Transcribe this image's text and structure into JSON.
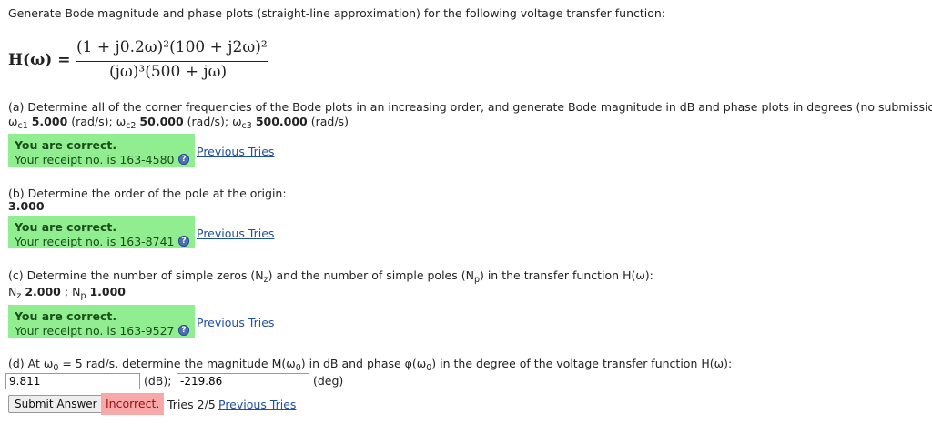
{
  "intro": "Generate Bode magnitude and phase plots (straight-line approximation) for the following voltage transfer function:",
  "formula": {
    "lhs": "H(ω) =",
    "numerator": "(1 + j0.2ω)²(100 + j2ω)²",
    "denominator": "(jω)³(500 + jω)"
  },
  "part_a": {
    "question": "(a) Determine all of the corner frequencies of the Bode plots in an increasing order, and generate Bode magnitude in dB and phase plots in degrees (no submission).",
    "answers": [
      {
        "sym": "ω",
        "sub": "c1",
        "value": "5.000",
        "unit": "(rad/s);"
      },
      {
        "sym": "ω",
        "sub": "c2",
        "value": "50.000",
        "unit": "(rad/s);"
      },
      {
        "sym": "ω",
        "sub": "c3",
        "value": "500.000",
        "unit": "(rad/s)"
      }
    ],
    "status": "You are correct.",
    "receipt": "Your receipt no. is 163-4580"
  },
  "part_b": {
    "question": "(b) Determine the order of the pole at the origin:",
    "answer": "3.000",
    "status": "You are correct.",
    "receipt": "Your receipt no. is 163-8741"
  },
  "part_c": {
    "question_pre": "(c) Determine the number of simple zeros (N",
    "question_zsub": "z",
    "question_mid": ") and the number of simple poles (N",
    "question_psub": "p",
    "question_post": ") in the transfer function H(ω):",
    "nz_label": "N",
    "nz_sub": "z",
    "nz_value": "2.000",
    "sep": ";",
    "np_label": "N",
    "np_sub": "p",
    "np_value": "1.000",
    "status": "You are correct.",
    "receipt": "Your receipt no. is 163-9527"
  },
  "part_d": {
    "question_pre": "(d) At ω",
    "question_sub": "0",
    "question_mid": " = 5 rad/s, determine the magnitude M(ω",
    "question_sub2": "0",
    "question_mid2": ") in dB and phase φ(ω",
    "question_sub3": "0",
    "question_post": ") in the degree of the voltage transfer function H(ω):",
    "mag_value": "9.811",
    "mag_unit": "(dB);",
    "phase_value": "-219.86",
    "phase_unit": "(deg)",
    "submit_label": "Submit Answer",
    "result": "Incorrect.",
    "tries": "Tries 2/5"
  },
  "previous_tries_label": "Previous Tries",
  "help_glyph": "?",
  "colors": {
    "correct_bg": "#90ee90",
    "incorrect_bg": "#f7a8a8",
    "link": "#2050a0"
  }
}
